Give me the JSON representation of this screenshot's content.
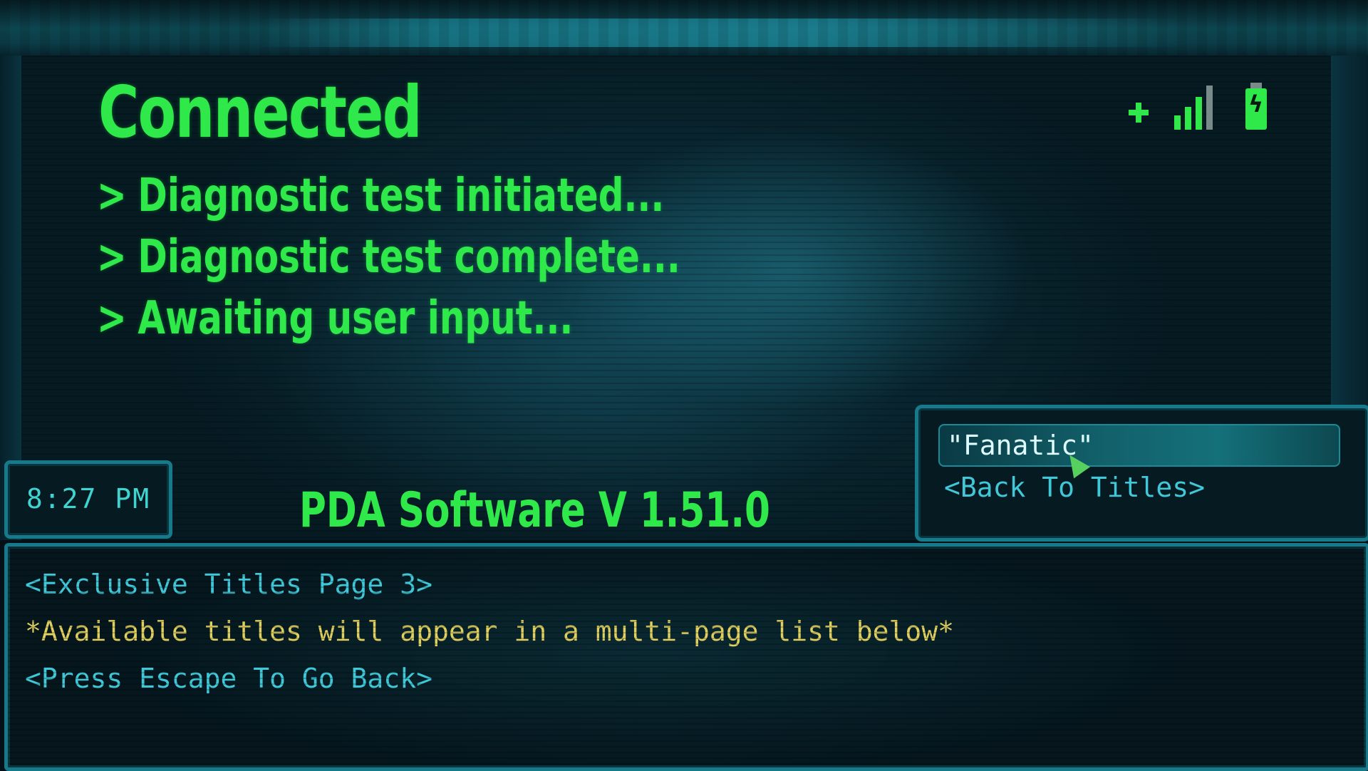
{
  "status": {
    "title": "Connected",
    "log": [
      {
        "prompt": ">",
        "text": "Diagnostic test initiated..."
      },
      {
        "prompt": ">",
        "text": "Diagnostic test complete..."
      },
      {
        "prompt": ">",
        "text": "Awaiting user input..."
      }
    ],
    "icons": [
      "plus-icon",
      "signal-icon",
      "battery-icon"
    ],
    "signal_bars_active": 3,
    "signal_bars_total": 4,
    "battery_symbol": "ϟ"
  },
  "clock": {
    "time": "8:27 PM"
  },
  "version": {
    "label": "PDA Software V 1.51.0"
  },
  "menu": {
    "items": [
      {
        "label": "\"Fanatic\"",
        "selected": true
      },
      {
        "label": "<Back To Titles>",
        "selected": false
      }
    ]
  },
  "console": {
    "lines": [
      "<Exclusive Titles Page 3>",
      "*Available titles will appear in a multi-page list below*",
      "<Press Escape To Go Back>"
    ]
  },
  "colors": {
    "accent_green": "#2fe84a",
    "cyan_text": "#40c8d8",
    "yellow_text": "#e0d060",
    "frame": "#177a8a"
  }
}
